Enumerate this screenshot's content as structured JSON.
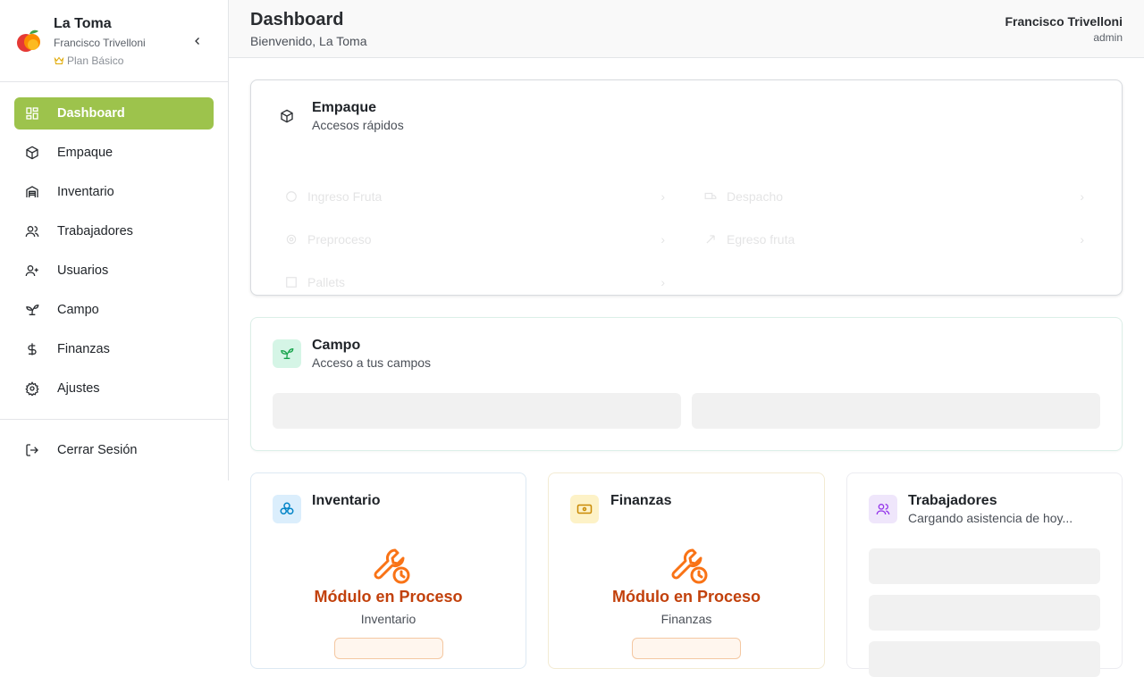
{
  "brand": {
    "name": "La Toma",
    "owner": "Francisco Trivelloni",
    "plan": "Plan Básico"
  },
  "nav": {
    "items": [
      {
        "label": "Dashboard",
        "icon": "grid-icon",
        "active": true
      },
      {
        "label": "Empaque",
        "icon": "package-icon",
        "active": false
      },
      {
        "label": "Inventario",
        "icon": "warehouse-icon",
        "active": false
      },
      {
        "label": "Trabajadores",
        "icon": "users-icon",
        "active": false
      },
      {
        "label": "Usuarios",
        "icon": "user-plus-icon",
        "active": false
      },
      {
        "label": "Campo",
        "icon": "sprout-icon",
        "active": false
      },
      {
        "label": "Finanzas",
        "icon": "dollar-icon",
        "active": false
      },
      {
        "label": "Ajustes",
        "icon": "gear-icon",
        "active": false
      }
    ],
    "logout": "Cerrar Sesión"
  },
  "header": {
    "title": "Dashboard",
    "subtitle": "Bienvenido, La Toma",
    "user_name": "Francisco Trivelloni",
    "user_role": "admin"
  },
  "empaque": {
    "title": "Empaque",
    "subtitle": "Accesos rápidos",
    "links": [
      "Ingreso Fruta",
      "Despacho",
      "Preproceso",
      "Egreso fruta",
      "Pallets"
    ]
  },
  "campo": {
    "title": "Campo",
    "subtitle": "Acceso a tus campos"
  },
  "inventario": {
    "title": "Inventario",
    "status": "Módulo en Proceso",
    "module": "Inventario"
  },
  "finanzas": {
    "title": "Finanzas",
    "status": "Módulo en Proceso",
    "module": "Finanzas"
  },
  "trabajadores": {
    "title": "Trabajadores",
    "subtitle": "Cargando asistencia de hoy..."
  },
  "colors": {
    "accent": "#9dc34c",
    "in_progress": "#c2410c",
    "wrench": "#f97316"
  }
}
